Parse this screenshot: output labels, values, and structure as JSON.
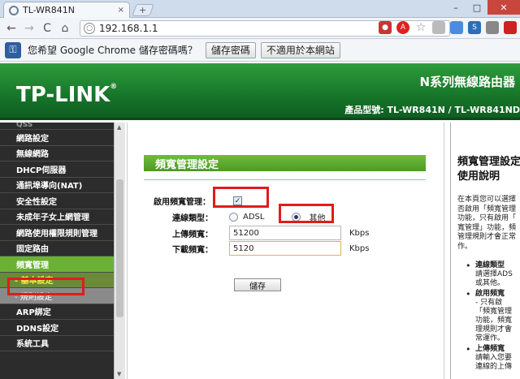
{
  "browser": {
    "tab_title": "TL-WR841N",
    "tab_close": "×",
    "new_tab": "+",
    "minimize": "–",
    "maximize": "□",
    "close": "✕",
    "url": "192.168.1.1",
    "back": "←",
    "forward": "→",
    "reload": "C",
    "home": "⌂"
  },
  "infobar": {
    "message": "您希望 Google Chrome 儲存密碼嗎？",
    "save_button": "儲存密碼",
    "never_button": "不適用於本網站"
  },
  "header": {
    "logo": "TP-LINK",
    "logo_mark": "®",
    "product_title": "N系列無線路由器",
    "model_label": "產品型號: TL-WR841N / TL-WR841ND"
  },
  "sidebar": {
    "cut_item": "QSS",
    "items": [
      "網路設定",
      "無線網路",
      "DHCP伺服器",
      "通訊埠導向(NAT)",
      "安全性設定",
      "未成年子女上網管理",
      "網路使用權限規則管理",
      "固定路由",
      "頻寬管理",
      "- 基本設定",
      "- 規則設定",
      "ARP綁定",
      "DDNS設定",
      "系統工具"
    ]
  },
  "form": {
    "title": "頻寬管理設定",
    "enable_label": "啟用頻寬管理：",
    "enable_checked": "✓",
    "type_label": "連線類型：",
    "type_adsl": "ADSL",
    "type_other": "其他",
    "up_label": "上傳頻寬：",
    "up_value": "51200",
    "down_label": "下載頻寬：",
    "down_value": "5120",
    "unit": "Kbps",
    "save": "儲存"
  },
  "help": {
    "title_1": "頻寬管理設定",
    "title_2": "使用說明",
    "para": [
      "在本頁您可以選擇",
      "否啟用「頻寬管理",
      "功能，只有啟用「",
      "寬管理」功能，頻",
      "管理規則才會正常",
      "作。"
    ],
    "bullets": [
      {
        "head": "連線類型",
        "lines": [
          "請選擇ADS",
          "或其他。"
        ]
      },
      {
        "head": "啟用頻寬",
        "lines": [
          "- 只有啟",
          "「頻寬管理",
          "功能，頻寬",
          "理規則才會",
          "常運作。"
        ]
      },
      {
        "head": "上傳頻寬",
        "lines": [
          "請輸入您要",
          "連線的上傳"
        ]
      }
    ]
  }
}
